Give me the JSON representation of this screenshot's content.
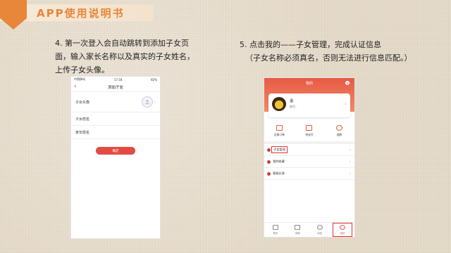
{
  "header": {
    "title": "APP使用说明书",
    "accent_color": "#e8863a"
  },
  "step4": {
    "text": "4. 第一次登入会自动跳转到添加子女页面，输入家长名称以及真实的子女姓名，上传子女头像。"
  },
  "step5": {
    "line1": "5. 点击我的——子女管理，完成认证信息",
    "note": "（子女名称必须真名，否则无法进行信息匹配。）"
  },
  "phone1": {
    "status": {
      "carrier": "中国移动",
      "time": "17:18",
      "battery": "82%"
    },
    "nav_title": "添加子女",
    "rows": [
      {
        "label": "子女头像"
      },
      {
        "label": "子女姓名"
      },
      {
        "label": "家长姓名"
      }
    ],
    "confirm_label": "确定"
  },
  "phone2": {
    "top_title": "我的",
    "profile": {
      "name": "温",
      "account": "账号："
    },
    "orders": [
      "全部订单",
      "待支付",
      "退款"
    ],
    "menu": [
      "子女管理",
      "我的收藏",
      "客服反馈"
    ],
    "tabs": [
      "首页",
      "商城",
      "动态",
      "我的"
    ],
    "theme_color": "#e65a44",
    "highlight_color": "#e03030"
  }
}
